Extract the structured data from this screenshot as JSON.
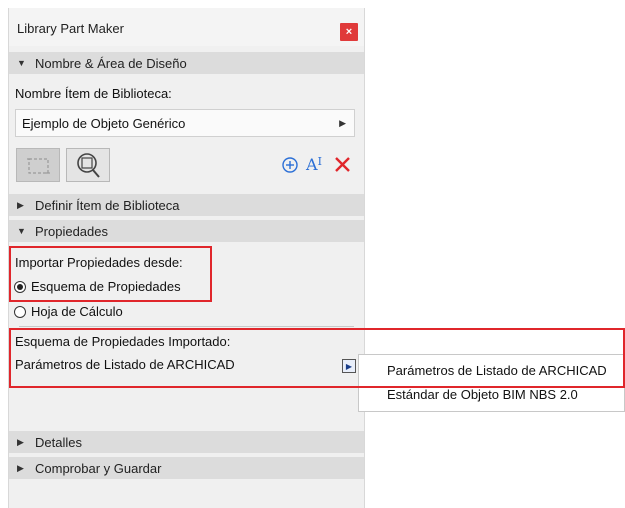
{
  "window": {
    "title": "Library Part Maker",
    "close_label": "×"
  },
  "sections": {
    "nombre": {
      "label": "Nombre & Área de Diseño",
      "expanded": true
    },
    "definir": {
      "label": "Definir Ítem de Biblioteca",
      "expanded": false
    },
    "propiedades": {
      "label": "Propiedades",
      "expanded": true
    },
    "detalles": {
      "label": "Detalles",
      "expanded": false
    },
    "comprobar": {
      "label": "Comprobar y Guardar",
      "expanded": false
    }
  },
  "nombre_area": {
    "field_label": "Nombre Ítem de Biblioteca:",
    "field_value": "Ejemplo de Objeto Genérico"
  },
  "propiedades": {
    "import_label": "Importar Propiedades desde:",
    "options": [
      "Esquema de Propiedades",
      "Hoja de Cálculo"
    ],
    "selected_option": "Esquema de Propiedades",
    "imported_label": "Esquema de Propiedades Importado:",
    "imported_value": "Parámetros de Listado de ARCHICAD"
  },
  "dropdown_menu": {
    "items": [
      "Parámetros de Listado de ARCHICAD",
      "Estándar de Objeto BIM NBS 2.0"
    ]
  },
  "colors": {
    "highlight": "#e0262b",
    "accent_blue": "#2b6fd6",
    "delete_red": "#e0262b",
    "header_bg": "#dcdcdc"
  }
}
